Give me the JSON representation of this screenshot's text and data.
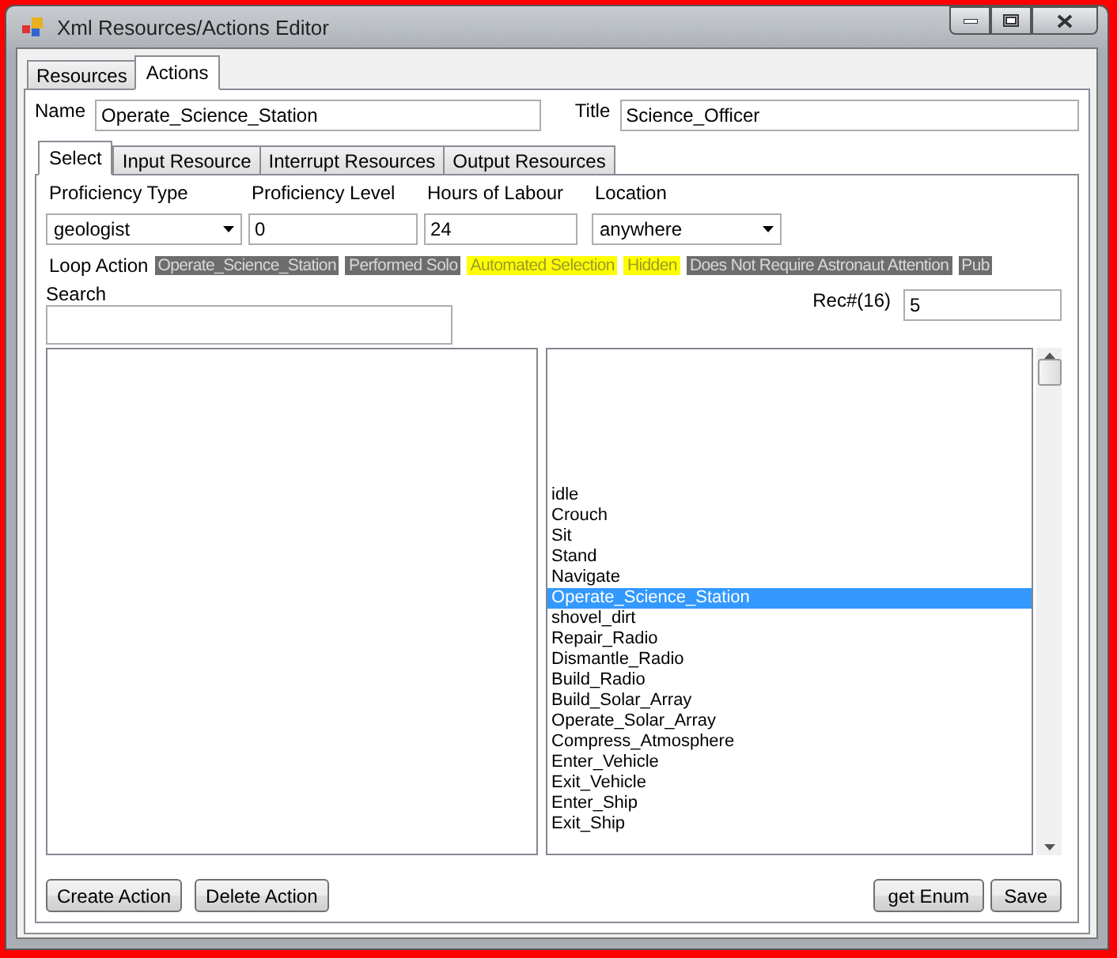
{
  "window": {
    "title": "Xml Resources/Actions Editor"
  },
  "tabs": [
    {
      "label": "Resources",
      "selected": false
    },
    {
      "label": "Actions",
      "selected": true
    }
  ],
  "name_field": {
    "label": "Name",
    "value": "Operate_Science_Station"
  },
  "title_field": {
    "label": "Title",
    "value": "Science_Officer"
  },
  "sub_tabs": [
    {
      "label": "Select",
      "selected": true
    },
    {
      "label": "Input Resource",
      "selected": false
    },
    {
      "label": "Interrupt Resources",
      "selected": false
    },
    {
      "label": "Output Resources",
      "selected": false
    }
  ],
  "fields": [
    {
      "label": "Proficiency Type",
      "value": "geologist",
      "kind": "dropdown"
    },
    {
      "label": "Proficiency Level",
      "value": "0",
      "kind": "text"
    },
    {
      "label": "Hours of Labour",
      "value": "24",
      "kind": "text"
    },
    {
      "label": "Location",
      "value": "anywhere",
      "kind": "dropdown"
    }
  ],
  "loop_action": {
    "label": "Loop Action",
    "tags": [
      {
        "text": "Operate_Science_Station",
        "color": "#6d6d6d"
      },
      {
        "text": "Performed Solo",
        "color": "#6d6d6d"
      },
      {
        "text": "Automated Selection",
        "color": "#ffff00"
      },
      {
        "text": "Hidden",
        "color": "#ffff00"
      },
      {
        "text": "Does Not Require Astronaut Attention",
        "color": "#6d6d6d"
      },
      {
        "text": "Pub",
        "color": "#6d6d6d"
      }
    ]
  },
  "search": {
    "label": "Search"
  },
  "record": {
    "label": "Rec#(16)",
    "value": "5"
  },
  "action_list": {
    "items": [
      {
        "text": "idle",
        "selected": false
      },
      {
        "text": "Crouch",
        "selected": false
      },
      {
        "text": "Sit",
        "selected": false
      },
      {
        "text": "Stand",
        "selected": false
      },
      {
        "text": "Navigate",
        "selected": false
      },
      {
        "text": "Operate_Science_Station",
        "selected": true
      },
      {
        "text": "shovel_dirt",
        "selected": false
      },
      {
        "text": "Repair_Radio",
        "selected": false
      },
      {
        "text": "Dismantle_Radio",
        "selected": false
      },
      {
        "text": "Build_Radio",
        "selected": false
      },
      {
        "text": "Build_Solar_Array",
        "selected": false
      },
      {
        "text": "Operate_Solar_Array",
        "selected": false
      },
      {
        "text": "Compress_Atmosphere",
        "selected": false
      },
      {
        "text": "Enter_Vehicle",
        "selected": false
      },
      {
        "text": "Exit_Vehicle",
        "selected": false
      },
      {
        "text": "Enter_Ship",
        "selected": false
      },
      {
        "text": "Exit_Ship",
        "selected": false
      }
    ]
  },
  "buttons_left": [
    "Create Action",
    "Delete Action"
  ],
  "buttons_right": [
    "get Enum",
    "Save"
  ]
}
